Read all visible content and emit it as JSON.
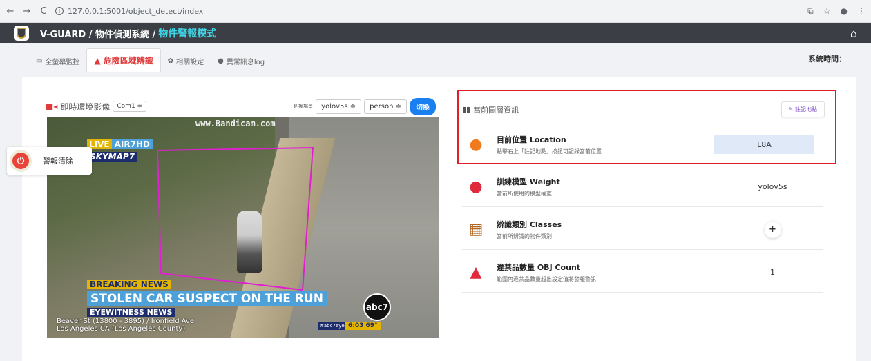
{
  "browser": {
    "back": "←",
    "forward": "→",
    "reload": "C",
    "info": "i",
    "url": "127.0.0.1:5001/object_detect/index",
    "right_icons": [
      "translate",
      "star",
      "profile",
      "menu"
    ]
  },
  "header": {
    "brand": "V-GUARD / 物件偵測系統 /",
    "mode": "物件警報模式",
    "home_icon": "home-icon"
  },
  "tabs": [
    {
      "label": "全螢幕監控",
      "icon": "▭"
    },
    {
      "label": "危險區域辨識",
      "icon": "▲"
    },
    {
      "label": "相關設定",
      "icon": "✿"
    },
    {
      "label": "異常訊息log",
      "icon": "●"
    }
  ],
  "system_time_label": "系統時間：",
  "video": {
    "label": "即時環境影像",
    "camera": "Com1 ≑",
    "switch_scene_tag": "切換場景",
    "model_select": "yolov5s ≑",
    "class_select": "person ≑",
    "switch_button": "切換",
    "overlay": {
      "watermark": "www.Bandicam.com",
      "live": "LIVE",
      "channel": "AIR7HD",
      "skymap": "SKYMAP7",
      "breaking": "BREAKING NEWS",
      "headline": "STOLEN CAR SUSPECT ON THE RUN",
      "eyewitness": "EYEWITNESS NEWS",
      "address_line1": "Beaver St (13800 - 3895) / Ironfield Ave",
      "address_line2": "Los Angeles CA (Los Angeles County)",
      "hashtag": "#abc7eyewitness",
      "clock": "6:03  69°",
      "abc_logo": "abc7"
    }
  },
  "alarm": {
    "label": "警報清除"
  },
  "info": {
    "title": "當前圖層資訊",
    "mark_button": "註記地點",
    "rows": [
      {
        "title": "目前位置 Location",
        "desc": "點擊右上「註記地點」按鈕可記錄當前位置",
        "value": "L8A"
      },
      {
        "title": "訓練模型 Weight",
        "desc": "當前所使用的模型權重",
        "value": "yolov5s"
      },
      {
        "title": "辨識類別 Classes",
        "desc": "當前所辨識的物件類別",
        "value": "+"
      },
      {
        "title": "違禁品數量 OBJ Count",
        "desc": "範圍內違禁品數量超出設定值將發報警訊",
        "value": "1"
      }
    ]
  }
}
